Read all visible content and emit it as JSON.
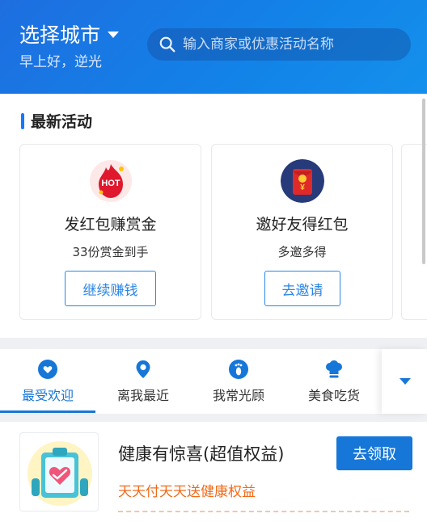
{
  "header": {
    "city_label": "选择城市",
    "greeting": "早上好，逆光",
    "search_placeholder": "输入商家或优惠活动名称",
    "icons": [
      "chevron-down-icon",
      "search-icon"
    ]
  },
  "activities": {
    "title": "最新活动",
    "cards": [
      {
        "icon": "hot-icon",
        "title": "发红包赚赏金",
        "subtitle": "33份赏金到手",
        "button": "继续赚钱"
      },
      {
        "icon": "red-envelope-icon",
        "title": "邀好友得红包",
        "subtitle": "多邀多得",
        "button": "去邀请"
      }
    ]
  },
  "tabs": {
    "items": [
      {
        "label": "最受欢迎",
        "icon": "heart-icon",
        "active": true
      },
      {
        "label": "离我最近",
        "icon": "location-pin-icon",
        "active": false
      },
      {
        "label": "我常光顾",
        "icon": "footprint-icon",
        "active": false
      },
      {
        "label": "美食吃货",
        "icon": "chef-hat-icon",
        "active": false
      }
    ],
    "more_icon": "chevron-down-icon"
  },
  "promo": {
    "title": "健康有惊喜(超值权益)",
    "subtitle": "天天付天天送健康权益",
    "button": "去领取",
    "icon": "health-heart-icon"
  },
  "colors": {
    "header_blue": "#1677e0",
    "accent": "#1677d8",
    "promo_orange": "#f06a1a"
  }
}
